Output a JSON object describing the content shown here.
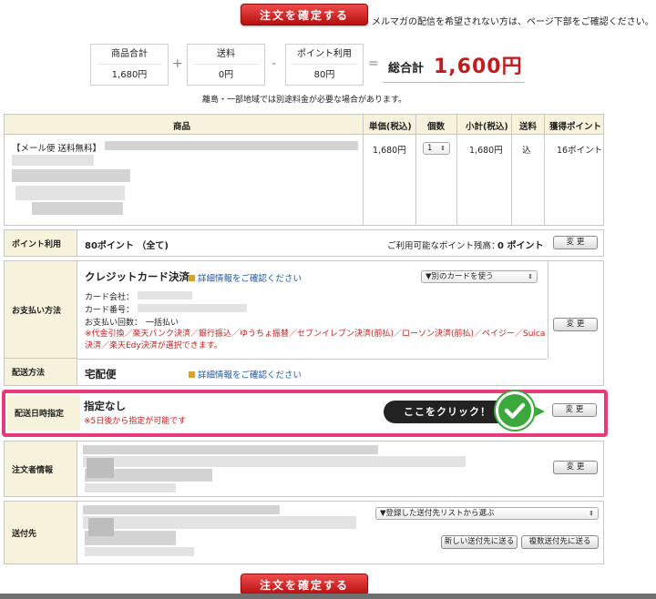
{
  "confirm_button": "注文を確定する",
  "mailmag_note": "メルマガの配信を希望されない方は、ページ下部をご確認ください。",
  "summary": {
    "subtotal_label": "商品合計",
    "subtotal_value": "1,680円",
    "shipping_label": "送料",
    "shipping_value": "0円",
    "points_label": "ポイント利用",
    "points_value": "80円",
    "plus": "+",
    "minus": "-",
    "equals": "=",
    "total_label": "総合計",
    "total_value": "1,600円",
    "remote_note": "離島・一部地域では別途料金が必要な場合があります。"
  },
  "goods_table": {
    "headers": [
      "商品",
      "単価(税込)",
      "個数",
      "小計(税込)",
      "送料",
      "獲得ポイント"
    ],
    "item_title": "【メール便 送料無料】",
    "unit_price": "1,680円",
    "quantity": "1",
    "subtotal": "1,680円",
    "shipping": "込",
    "earned_points": "16ポイント"
  },
  "points_row": {
    "label": "ポイント利用",
    "value": "80ポイント （全て)",
    "available": "ご利用可能なポイント残高：",
    "available_value": "0 ポイント",
    "change": "変 更"
  },
  "payment_row": {
    "label": "お支払い方法",
    "method": "クレジットカード決済",
    "detail_link": "詳細情報をご確認ください",
    "card_select": "▼別のカードを使う",
    "card_company": "カード会社：",
    "card_number": "カード番号：",
    "installments": "お支払い回数：",
    "installments_value": "一括払い",
    "note": "※代金引換／楽天バンク決済／銀行振込／ゆうちょ振替／セブンイレブン決済(前払)／ローソン決済(前払)／ペイジー／Suica決済／楽天Edy決済が選択できます。",
    "change": "変 更"
  },
  "delivery_row": {
    "label": "配送方法",
    "method": "宅配便",
    "detail_link": "詳細情報をご確認ください"
  },
  "delivery_date_row": {
    "label": "配送日時指定",
    "value": "指定なし",
    "note": "※5日後から指定が可能です",
    "callout": "ここをクリック！",
    "change": "変 更"
  },
  "orderer_row": {
    "label": "注文者情報",
    "change": "変 更"
  },
  "shipto_row": {
    "label": "送付先",
    "select": "▼登録した送付先リストから選ぶ",
    "new_button": "新しい送付先に送る",
    "multi_button": "複数送付先に送る"
  },
  "colors": {
    "accent_red": "#c01e1e",
    "highlight_pink": "#e8397a",
    "check_green": "#3aa83a",
    "header_beige": "#f6f2db"
  }
}
